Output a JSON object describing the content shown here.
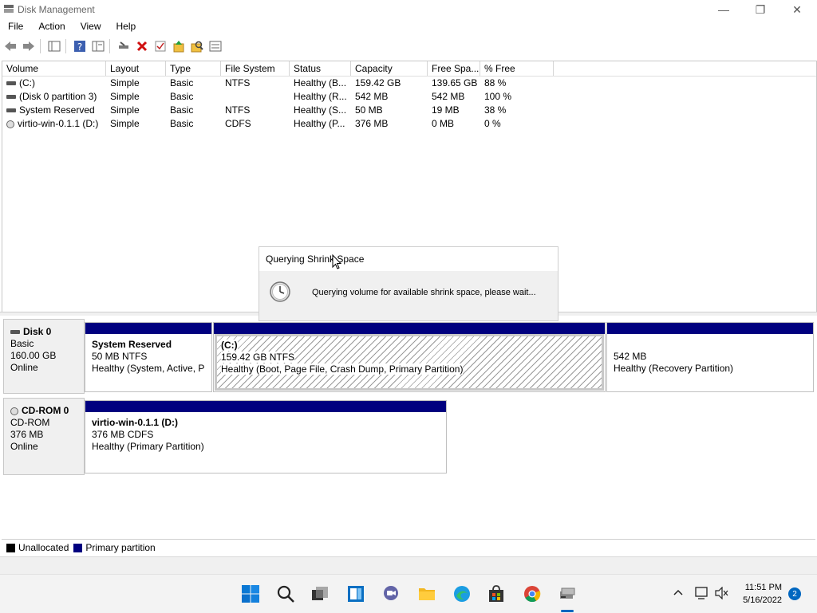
{
  "window": {
    "title": "Disk Management"
  },
  "menu": [
    "File",
    "Action",
    "View",
    "Help"
  ],
  "toolbar": {
    "icons": [
      "back-icon",
      "forward-icon",
      "console-tree-icon",
      "help-icon",
      "properties-icon",
      "connect-icon",
      "delete-icon",
      "check-icon",
      "export-up-icon",
      "search-folder-icon",
      "list-icon"
    ]
  },
  "volume_list": {
    "columns": [
      "Volume",
      "Layout",
      "Type",
      "File System",
      "Status",
      "Capacity",
      "Free Spa...",
      "% Free"
    ],
    "rows": [
      {
        "volume": "(C:)",
        "layout": "Simple",
        "type": "Basic",
        "fs": "NTFS",
        "status": "Healthy (B...",
        "capacity": "159.42 GB",
        "free": "139.65 GB",
        "pct": "88 %",
        "icon": "disk-volume-icon"
      },
      {
        "volume": "(Disk 0 partition 3)",
        "layout": "Simple",
        "type": "Basic",
        "fs": "",
        "status": "Healthy (R...",
        "capacity": "542 MB",
        "free": "542 MB",
        "pct": "100 %",
        "icon": "disk-volume-icon"
      },
      {
        "volume": "System Reserved",
        "layout": "Simple",
        "type": "Basic",
        "fs": "NTFS",
        "status": "Healthy (S...",
        "capacity": "50 MB",
        "free": "19 MB",
        "pct": "38 %",
        "icon": "disk-volume-icon"
      },
      {
        "volume": "virtio-win-0.1.1 (D:)",
        "layout": "Simple",
        "type": "Basic",
        "fs": "CDFS",
        "status": "Healthy (P...",
        "capacity": "376 MB",
        "free": "0 MB",
        "pct": "0 %",
        "icon": "cd-volume-icon"
      }
    ]
  },
  "disks": [
    {
      "name": "Disk 0",
      "kind": "Basic",
      "size": "160.00 GB",
      "state": "Online",
      "partitions": [
        {
          "name": "System Reserved",
          "size": "50 MB NTFS",
          "status": "Healthy (System, Active, Pri"
        },
        {
          "name": "(C:)",
          "size": "159.42 GB NTFS",
          "status": "Healthy (Boot, Page File, Crash Dump, Primary Partition)"
        },
        {
          "name": "",
          "size": "542 MB",
          "status": "Healthy (Recovery Partition)"
        }
      ]
    },
    {
      "name": "CD-ROM 0",
      "kind": "CD-ROM",
      "size": "376 MB",
      "state": "Online",
      "partitions": [
        {
          "name": "virtio-win-0.1.1  (D:)",
          "size": "376 MB CDFS",
          "status": "Healthy (Primary Partition)"
        }
      ]
    }
  ],
  "legend": [
    {
      "label": "Unallocated",
      "color": "#000000"
    },
    {
      "label": "Primary partition",
      "color": "#00007f"
    }
  ],
  "dialog": {
    "title": "Querying Shrink Space",
    "message": "Querying volume for available shrink space, please wait..."
  },
  "taskbar": {
    "time": "11:51 PM",
    "date": "5/16/2022",
    "notification_count": "2",
    "apps": [
      "start-icon",
      "search-icon",
      "task-view-icon",
      "widgets-icon",
      "chat-icon",
      "file-explorer-icon",
      "edge-icon",
      "store-icon",
      "chrome-icon",
      "disk-management-icon"
    ]
  },
  "colors": {
    "primary_partition": "#00007f",
    "accent": "#0067c0"
  }
}
